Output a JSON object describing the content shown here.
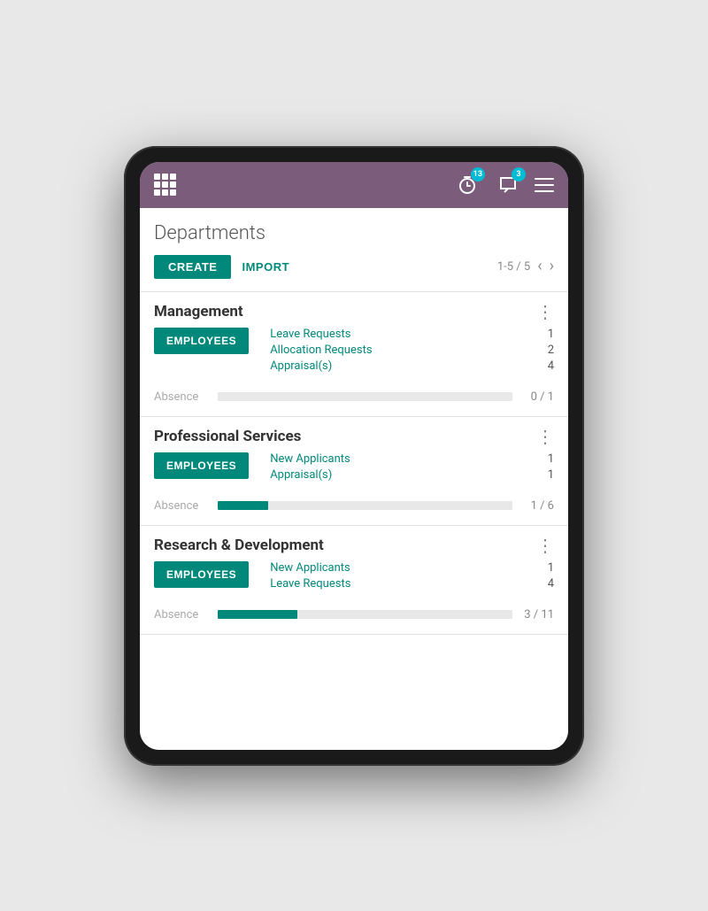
{
  "navbar": {
    "grid_icon_label": "apps-grid",
    "notifications_badge": "13",
    "messages_badge": "3"
  },
  "page": {
    "title": "Departments",
    "toolbar": {
      "create_label": "CREATE",
      "import_label": "IMPORT",
      "pagination_text": "1-5 / 5"
    }
  },
  "departments": [
    {
      "name": "Management",
      "employees_label": "EMPLOYEES",
      "stats": [
        {
          "label": "Leave Requests",
          "value": "1"
        },
        {
          "label": "Allocation Requests",
          "value": "2"
        },
        {
          "label": "Appraisal(s)",
          "value": "4"
        }
      ],
      "absence_label": "Absence",
      "absence_current": 0,
      "absence_total": 1,
      "absence_text": "0 / 1",
      "absence_pct": 0
    },
    {
      "name": "Professional Services",
      "employees_label": "EMPLOYEES",
      "stats": [
        {
          "label": "New Applicants",
          "value": "1"
        },
        {
          "label": "Appraisal(s)",
          "value": "1"
        }
      ],
      "absence_label": "Absence",
      "absence_current": 1,
      "absence_total": 6,
      "absence_text": "1 / 6",
      "absence_pct": 17
    },
    {
      "name": "Research & Development",
      "employees_label": "EMPLOYEES",
      "stats": [
        {
          "label": "New Applicants",
          "value": "1"
        },
        {
          "label": "Leave Requests",
          "value": "4"
        }
      ],
      "absence_label": "Absence",
      "absence_current": 3,
      "absence_total": 11,
      "absence_text": "3 / 11",
      "absence_pct": 27
    }
  ]
}
